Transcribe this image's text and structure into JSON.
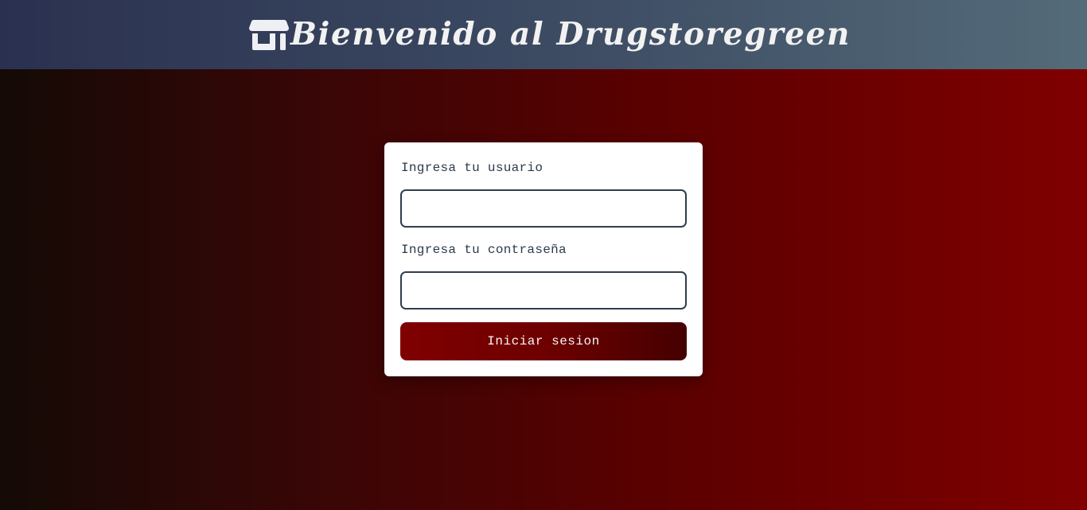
{
  "header": {
    "icon": "store-icon",
    "title": "Bienvenido al Drugstoregreen"
  },
  "login": {
    "username_label": "Ingresa tu usuario",
    "username_value": "",
    "password_label": "Ingresa tu contraseña",
    "password_value": "",
    "submit_label": "Iniciar sesion"
  },
  "colors": {
    "header_gradient_start": "#2a3150",
    "header_gradient_end": "#546b79",
    "background_gradient_start": "#140a06",
    "background_gradient_end": "#800000",
    "button_gradient_start": "#800000",
    "button_gradient_end": "#450000",
    "input_border": "#2f3d4e"
  }
}
